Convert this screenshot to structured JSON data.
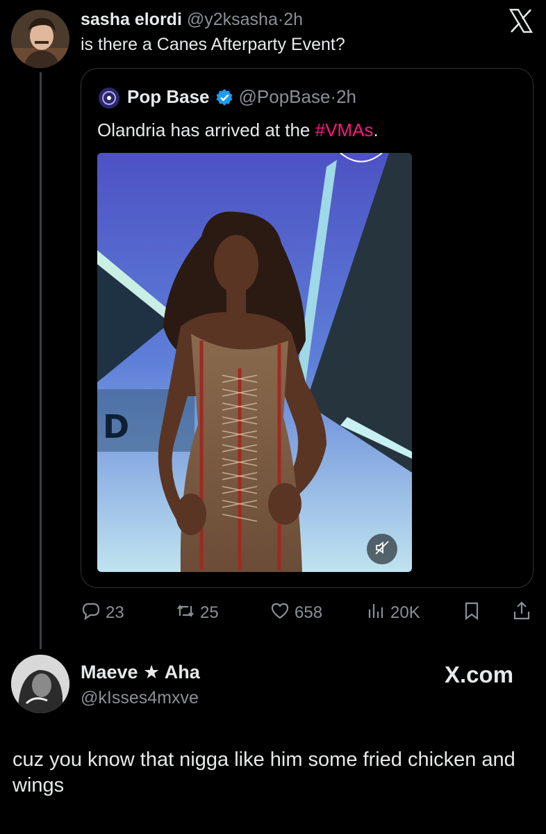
{
  "main_tweet": {
    "display_name": "sasha elordi",
    "handle": "@y2ksasha",
    "dot": "·",
    "time": "2h",
    "text": "is there a Canes Afterparty Event?"
  },
  "quoted_tweet": {
    "display_name": "Pop Base",
    "handle": "@PopBase",
    "dot": "·",
    "time": "2h",
    "text_before": "Olandria has arrived at the ",
    "hashtag": "#VMAs",
    "text_after": "."
  },
  "actions": {
    "replies": "23",
    "reposts": "25",
    "likes": "658",
    "views": "20K"
  },
  "reply": {
    "display_name": "Maeve ★ Aha",
    "handle": "@kIsses4mxve",
    "brand": "X.com",
    "text": "cuz you know that nigga like him some fried chicken and wings"
  },
  "colors": {
    "background": "#000000",
    "text": "#e7e9ea",
    "muted": "#8b9096",
    "hashtag": "#f91880",
    "verified": "#1d9bf0"
  },
  "icons": [
    "x-logo-icon",
    "verified-badge-icon",
    "reply-icon",
    "repost-icon",
    "like-icon",
    "views-icon",
    "bookmark-icon",
    "share-icon",
    "mute-icon"
  ]
}
